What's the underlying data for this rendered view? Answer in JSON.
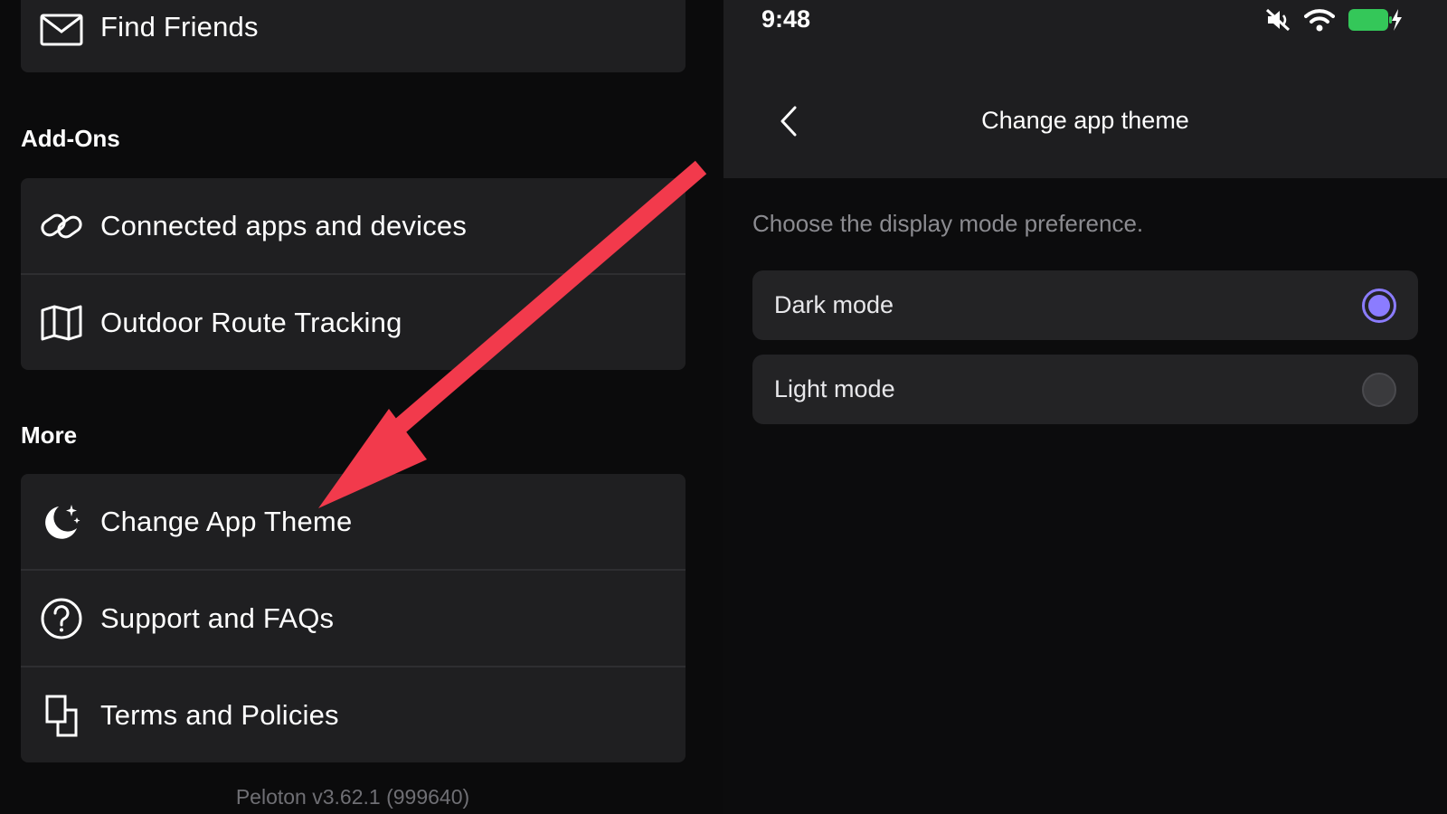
{
  "left": {
    "top_item": {
      "label": "Find Friends",
      "icon": "envelope-icon"
    },
    "addons": {
      "title": "Add-Ons",
      "items": [
        {
          "label": "Connected apps and devices",
          "icon": "link-icon"
        },
        {
          "label": "Outdoor Route Tracking",
          "icon": "map-icon"
        }
      ]
    },
    "more": {
      "title": "More",
      "items": [
        {
          "label": "Change App Theme",
          "icon": "moon-stars-icon"
        },
        {
          "label": "Support and FAQs",
          "icon": "question-circle-icon"
        },
        {
          "label": "Terms and Policies",
          "icon": "documents-icon"
        }
      ]
    },
    "version": "Peloton v3.62.1 (999640)"
  },
  "right": {
    "status_bar": {
      "time": "9:48",
      "icons": [
        "mute-icon",
        "wifi-icon",
        "battery-charging-icon"
      ]
    },
    "title": "Change app theme",
    "hint": "Choose the display mode preference.",
    "options": [
      {
        "label": "Dark mode",
        "selected": true
      },
      {
        "label": "Light mode",
        "selected": false
      }
    ]
  },
  "colors": {
    "accent": "#8b7cff",
    "arrow": "#f23a4c",
    "card": "#1f1f21",
    "background": "#0b0b0c"
  }
}
